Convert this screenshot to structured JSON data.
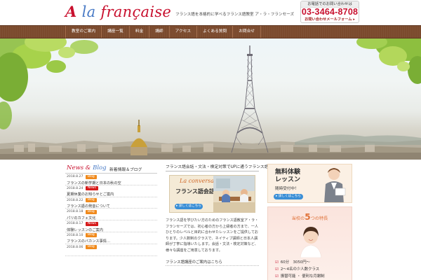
{
  "header": {
    "logo_a": "A",
    "logo_la": "la",
    "logo_fr": "française",
    "tagline": "フランス語を本格的に学べるフランス語教室 ア・ラ・フランセーズ",
    "contact_label": "お電話でのお問い合わせは",
    "contact_phone": "03-3464-8708",
    "contact_mail": "お問い合わせメールフォーム ▸"
  },
  "nav": {
    "items": [
      {
        "label": "教室のご案内"
      },
      {
        "label": "講座一覧"
      },
      {
        "label": "料金"
      },
      {
        "label": "講師"
      },
      {
        "label": "アクセス"
      },
      {
        "label": "よくある質問"
      },
      {
        "label": "お問合せ"
      }
    ]
  },
  "news": {
    "logo_news": "News",
    "logo_amp": " & ",
    "logo_blog": "Blog",
    "title": "新着情報＆ブログ",
    "items": [
      {
        "date": "2018.8.27",
        "badge": "Blog",
        "kind": "blog",
        "title": "フランスの新学期と日本の秋の空"
      },
      {
        "date": "2018.8.24",
        "badge": "News",
        "kind": "news",
        "title": "夏期休業のお知らせとご案内"
      },
      {
        "date": "2018.8.22",
        "badge": "Blog",
        "kind": "blog",
        "title": "フランス語の発音について"
      },
      {
        "date": "2018.8.18",
        "badge": "Blog",
        "kind": "blog",
        "title": "パリのカフェ文化"
      },
      {
        "date": "2018.8.17",
        "badge": "News",
        "kind": "news",
        "title": "体験レッスンのご案内"
      },
      {
        "date": "2018.8.10",
        "badge": "Blog",
        "kind": "blog",
        "title": "フランスのバカンス事情…"
      },
      {
        "date": "2018.8.06",
        "badge": "Blog",
        "kind": "blog",
        "title": ""
      }
    ]
  },
  "center": {
    "title": "フランス語会話・文法・検定対策でUPに通うフランス語教室",
    "banner_script": "La conversation",
    "banner_title": "フランス語会話",
    "banner_button": "▸ 詳しくはこちら",
    "body": "フランス語を学びたい方のためのフランス語教室ア・ラ・フランセーズでは、初心者の方から上級者の方まで、一人ひとりのレベルと目的に合わせたレッスンをご提供しております。少人数制のクラスで、ネイティブ講師と日本人講師が丁寧に指導いたします。会話・文法・検定対策など、様々な講座をご用意しております。",
    "sub": "フランス語講座のご案内はこちら"
  },
  "trial": {
    "title": "無料体験レッスン",
    "sub": "随時受付中！",
    "button": "▸ 詳しくはこちら"
  },
  "features": {
    "title_pre": "当校の",
    "title_num": "5",
    "title_post": "つの特長",
    "items": [
      {
        "text": "60分　3050円〜"
      },
      {
        "text": "2〜4名の少人数クラス"
      },
      {
        "text": "振替可能 ・ 便利な月謝制"
      }
    ]
  },
  "colors": {
    "brand_red": "#c8102e",
    "brand_blue": "#4a7bc6",
    "nav_brown": "#7b4a2d",
    "badge_blog": "#f08a1c",
    "badge_news": "#d61b1b",
    "button_blue": "#3b8fd6"
  }
}
